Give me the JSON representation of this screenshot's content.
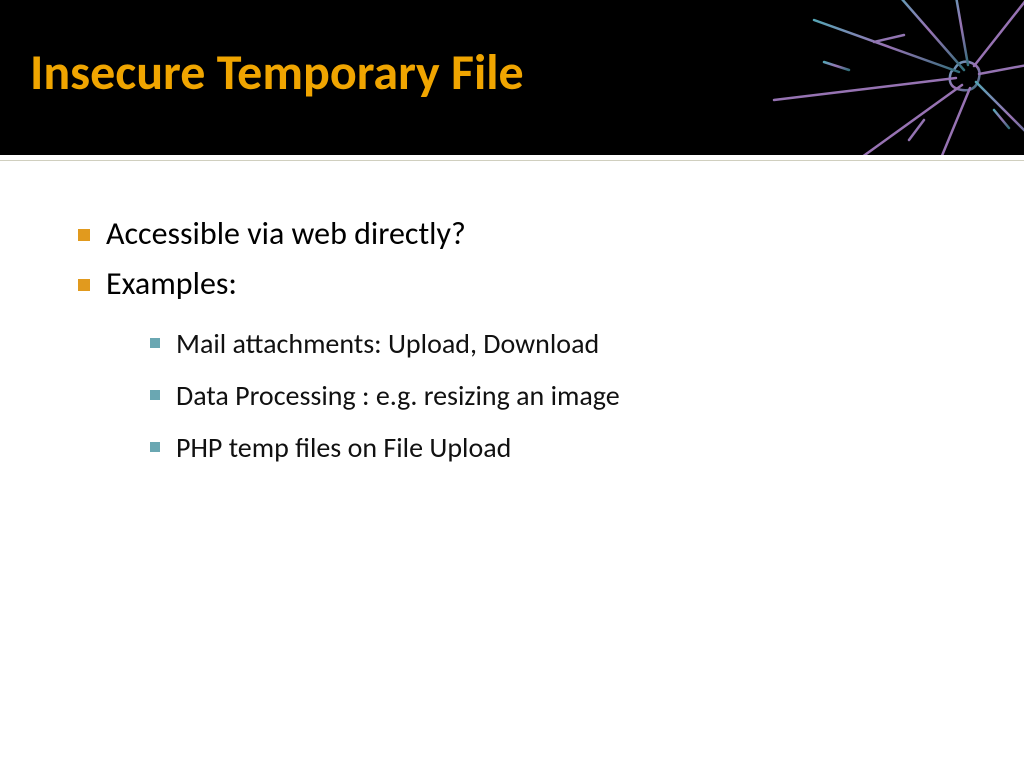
{
  "slide": {
    "title": "Insecure Temporary File",
    "bullets": [
      {
        "text": "Accessible via web directly?"
      },
      {
        "text": "Examples:"
      }
    ],
    "sub_bullets": [
      {
        "text": "Mail attachments: Upload, Download"
      },
      {
        "text": "Data Processing : e.g. resizing an image"
      },
      {
        "text": "PHP temp files on File Upload"
      }
    ],
    "colors": {
      "title": "#f0a500",
      "bullet_l1": "#e19a1e",
      "bullet_l2": "#6aa7b2",
      "header_bg": "#000000",
      "body_bg": "#ffffff"
    }
  }
}
